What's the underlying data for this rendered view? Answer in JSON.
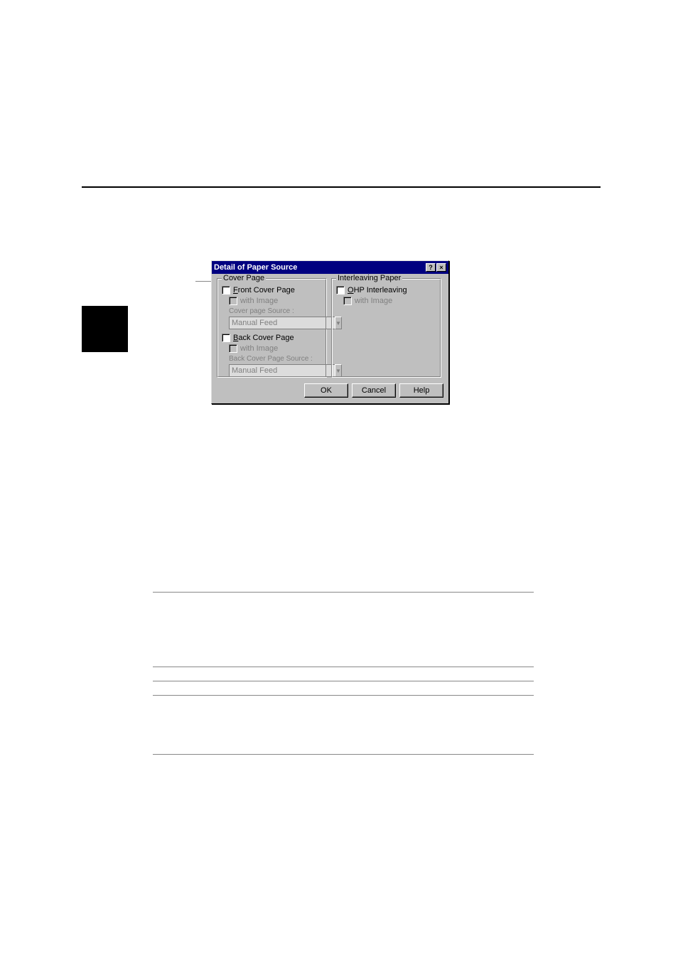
{
  "dialog": {
    "title": "Detail of Paper Source",
    "help_btn": "?",
    "close_btn": "×",
    "cover_page": {
      "legend": "Cover Page",
      "front_cover_page": "Front Cover Page",
      "front_with_image": "with Image",
      "cover_page_source": "Cover page Source :",
      "cover_page_tray": "Manual Feed",
      "back_cover_page": "Back Cover Page",
      "back_with_image": "with Image",
      "back_cover_page_source": "Back Cover Page Source :",
      "back_cover_page_tray": "Manual Feed"
    },
    "interleaving": {
      "legend": "Interleaving Paper",
      "ohp": "OHP Interleaving",
      "with_image": "with Image"
    },
    "buttons": {
      "ok": "OK",
      "cancel": "Cancel",
      "help": "Help"
    }
  }
}
